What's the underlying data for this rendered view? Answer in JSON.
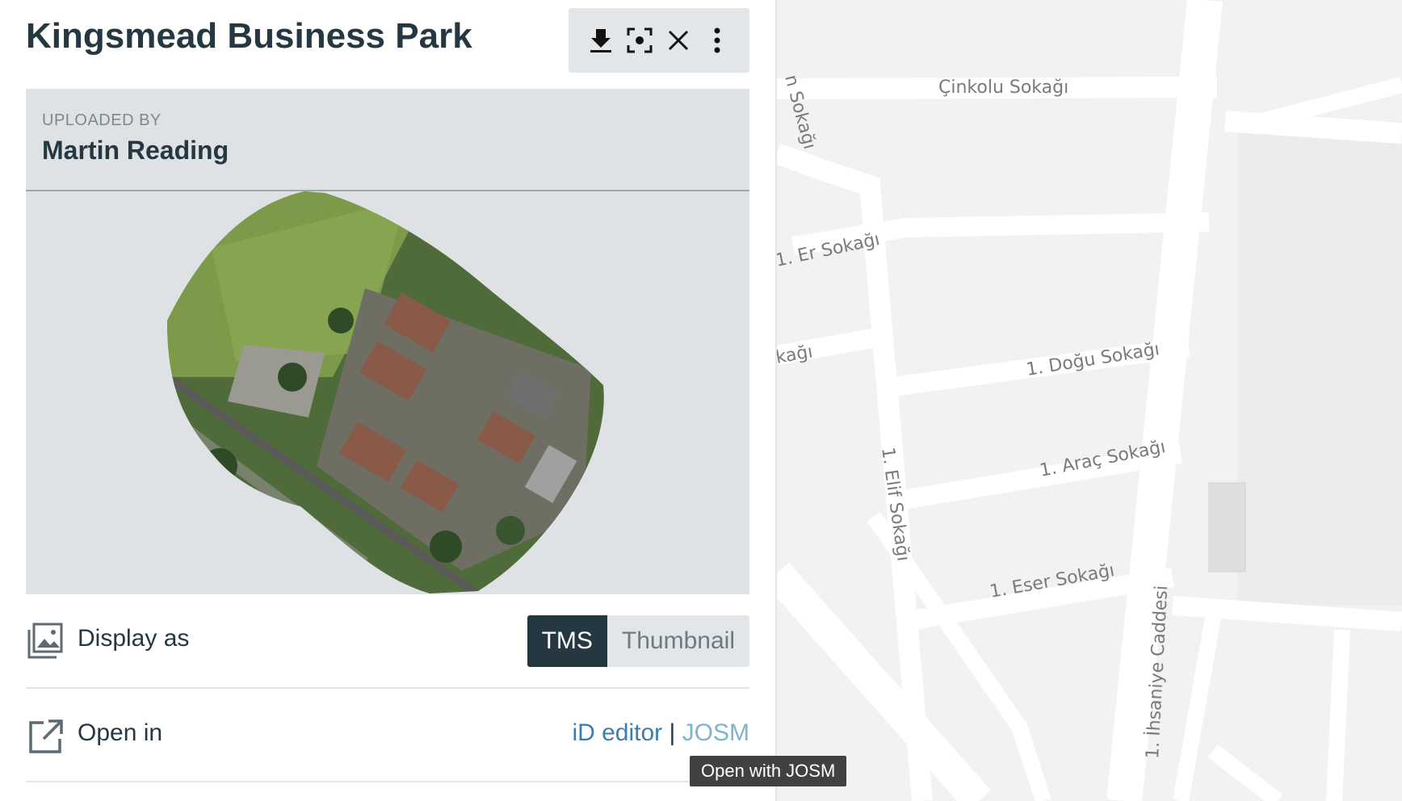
{
  "panel": {
    "title": "Kingsmead Business Park",
    "toolbar": {
      "download_icon": "download-icon",
      "zoom_icon": "focus-frame-icon",
      "close_icon": "close-icon",
      "more_icon": "more-vertical-icon"
    },
    "uploaded_by_label": "UPLOADED BY",
    "uploader": "Martin Reading",
    "display": {
      "label": "Display as",
      "icon": "image-gallery-icon",
      "options": [
        "TMS",
        "Thumbnail"
      ],
      "selected": "TMS"
    },
    "open_in": {
      "label": "Open in",
      "icon": "external-link-icon",
      "id_editor": "iD editor",
      "separator": "|",
      "josm": "JOSM"
    },
    "tooltip": "Open with JOSM"
  },
  "map": {
    "streets": [
      "Çinkolu Sokağı",
      "1. Er Sokağı",
      "1. Doğu Sokağı",
      "1. Araç Sokağı",
      "1. Eser Sokağı",
      "1. Elif Sokağı",
      "1. İhsaniye Caddesi",
      "n Sokağı",
      "kağı"
    ]
  },
  "colors": {
    "text_dark": "#253842",
    "panel_gray": "#e3e6e8",
    "card_gray": "#dfe2e5",
    "link_blue": "#3c7eab",
    "link_light": "#7fb3d0",
    "map_bg": "#f2f2f2"
  }
}
